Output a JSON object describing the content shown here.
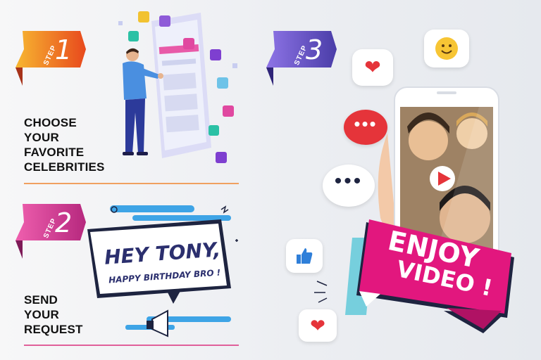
{
  "steps": [
    {
      "word": "STEP",
      "number": "1",
      "color_a": "#f39c12",
      "color_b": "#e8491d",
      "caption": [
        "CHOOSE",
        "YOUR",
        "FAVORITE",
        "CELEBRITIES"
      ]
    },
    {
      "word": "STEP",
      "number": "2",
      "color_a": "#e34a9a",
      "color_b": "#b6287e",
      "caption": [
        "SEND",
        "YOUR",
        "REQUEST"
      ]
    },
    {
      "word": "STEP",
      "number": "3",
      "color_a": "#7b5fd6",
      "color_b": "#4a3da8",
      "caption": []
    }
  ],
  "message": {
    "line1": "HEY TONY,",
    "line2": "HAPPY BIRTHDAY BRO !"
  },
  "banner": {
    "line1": "ENJOY",
    "line2": "VIDEO !",
    "color": "#e2177e"
  },
  "colors": {
    "divider_orange": "#f0a060",
    "divider_pink": "#e0609a",
    "heart": "#e5343a",
    "like": "#2f7fd9"
  },
  "icons": [
    "heart-icon",
    "smile-icon",
    "dots-icon",
    "play-icon",
    "like-icon",
    "megaphone-icon",
    "user-icon"
  ]
}
